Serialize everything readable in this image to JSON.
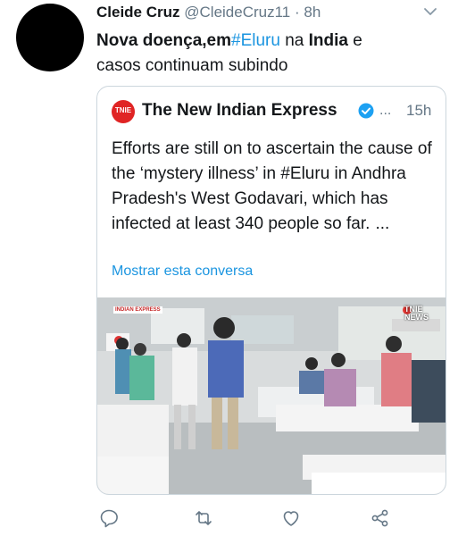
{
  "tweet": {
    "author_name": "Cleide Cruz",
    "handle": "@CleideCruz11",
    "separator": "·",
    "time": "8h",
    "text_nova": "Nova",
    "text_doenca": "doença,em",
    "hashtag": "#Eluru",
    "text_na": "na",
    "text_india": "India",
    "text_e": "e",
    "text_line2": "casos  continuam subindo"
  },
  "quote": {
    "logo_text": "TNIE",
    "name": "The New Indian Express",
    "handle": "...",
    "time": "15h",
    "text": "Efforts are still on to ascertain the cause of the ‘mystery illness’ in #Eluru in Andhra Pradesh's West Godavari, which has infected at least 340 people so far.",
    "ellipsis": "...",
    "show_thread": "Mostrar esta conversa",
    "media_watermark": "TNIE NEWS",
    "media_badge": "INDIAN EXPRESS"
  },
  "actions": [
    "reply-icon",
    "retweet-icon",
    "like-icon",
    "share-icon"
  ],
  "colors": {
    "link": "#1b95e0",
    "secondary": "#657786",
    "border": "#ccd6dd",
    "brand_red": "#e02424"
  }
}
